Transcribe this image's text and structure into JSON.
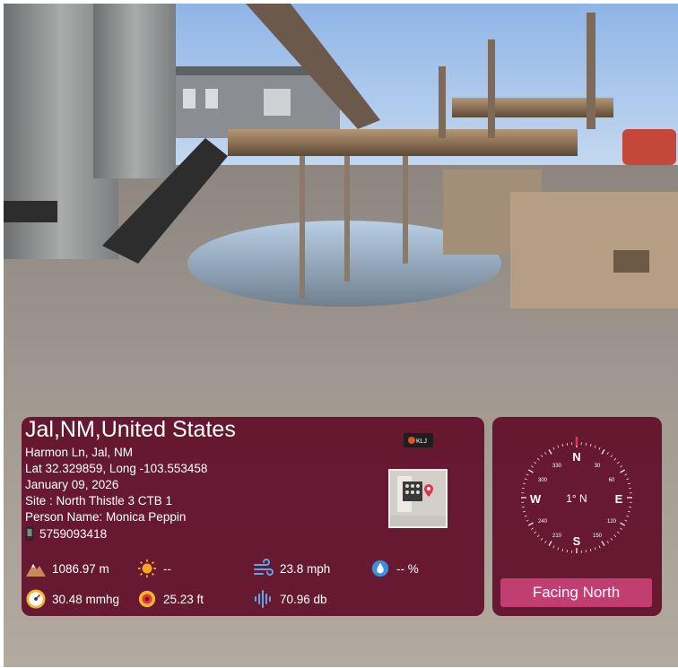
{
  "location": {
    "title": "Jal,NM,United States",
    "address": "Harmon Ln, Jal, NM",
    "coordinates": "Lat 32.329859, Long -103.553458",
    "date": "January 09, 2026",
    "site": "Site : North Thistle 3 CTB 1",
    "person": "Person Name: Monica Peppin",
    "phone": "5759093418"
  },
  "logo": {
    "text": "KLJ"
  },
  "metrics": {
    "altitude": "1086.97 m",
    "weather": "--",
    "wind": "23.8 mph",
    "humidity": "-- %",
    "pressure": "30.48 mmhg",
    "accuracy": "25.23 ft",
    "noise": "70.96 db"
  },
  "compass": {
    "heading": "1° N",
    "cardinals": [
      "N",
      "E",
      "S",
      "W"
    ],
    "degree_labels": [
      "30",
      "60",
      "120",
      "150",
      "210",
      "240",
      "300",
      "330"
    ],
    "facing_label": "Facing North"
  },
  "colors": {
    "card_bg": "#620e2a",
    "button_bg": "#c13e70",
    "needle": "#e0344a"
  }
}
